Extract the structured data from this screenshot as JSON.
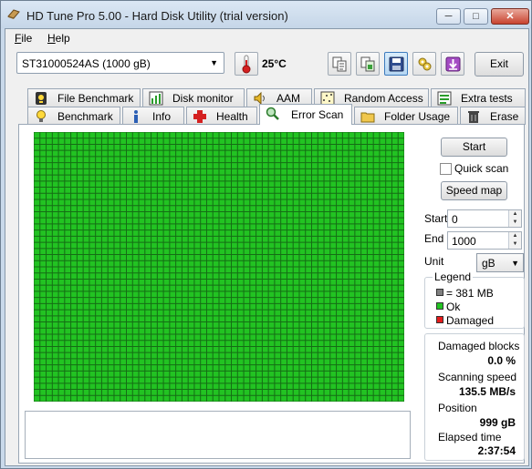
{
  "window": {
    "title": "HD Tune Pro 5.00 - Hard Disk Utility (trial version)"
  },
  "menu": [
    {
      "label": "File",
      "accel": "F",
      "rest": "ile"
    },
    {
      "label": "Help",
      "accel": "H",
      "rest": "elp"
    }
  ],
  "toolbar": {
    "drive": "ST31000524AS (1000 gB)",
    "temperature": "25°C",
    "exit_label": "Exit",
    "buttons": [
      "copy-text-icon",
      "copy-screenshot-icon",
      "save-icon",
      "options-icon",
      "download-icon"
    ]
  },
  "tabs_top": [
    "File Benchmark",
    "Disk monitor",
    "AAM",
    "Random Access",
    "Extra tests"
  ],
  "tabs_bottom": [
    "Benchmark",
    "Info",
    "Health",
    "Error Scan",
    "Folder Usage",
    "Erase"
  ],
  "active_tab": "Error Scan",
  "scan": {
    "start_label": "Start",
    "quick_scan_label": "Quick scan",
    "quick_scan_checked": false,
    "speed_map_label": "Speed map",
    "start_field_label": "Start",
    "start_value": "0",
    "end_field_label": "End",
    "end_value": "1000",
    "unit_label": "Unit",
    "unit_value": "gB",
    "grid_cells_ok": true
  },
  "legend": {
    "title": "Legend",
    "block_size": "= 381 MB",
    "ok": "Ok",
    "damaged": "Damaged"
  },
  "stats": {
    "damaged_blocks_label": "Damaged blocks",
    "damaged_blocks_value": "0.0 %",
    "scanning_speed_label": "Scanning speed",
    "scanning_speed_value": "135.5 MB/s",
    "position_label": "Position",
    "position_value": "999 gB",
    "elapsed_label": "Elapsed time",
    "elapsed_value": "2:37:54"
  },
  "colors": {
    "ok": "#22c322",
    "damaged": "#e51b1b",
    "block": "#808080",
    "grid_line": "#156d15"
  }
}
